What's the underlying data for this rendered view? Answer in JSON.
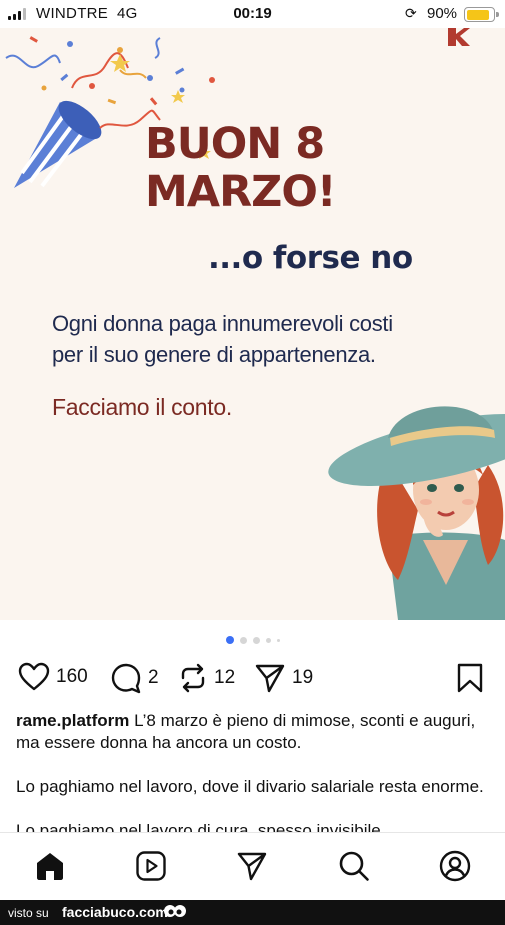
{
  "status_bar": {
    "carrier": "WINDTRE",
    "network": "4G",
    "time": "00:19",
    "battery_percent": "90%",
    "battery_level": 0.9,
    "battery_color": "#f5c518",
    "icons": [
      "signal-icon",
      "rotation-lock-icon",
      "battery-icon"
    ]
  },
  "post_image": {
    "headline_line1": "BUON 8",
    "headline_line2": "MARZO!",
    "subhead": "...o forse no",
    "body_line1": "Ogni donna paga innumerevoli costi",
    "body_line2": "per il suo genere di appartenenza.",
    "cta": "Facciamo il conto.",
    "colors": {
      "background": "#fbf5ef",
      "headline": "#7b2a23",
      "navy": "#1f2a4e"
    }
  },
  "carousel": {
    "pages": 5,
    "active": 0,
    "active_color": "#3b6ff5"
  },
  "actions": {
    "likes": "160",
    "comments": "2",
    "reposts": "12",
    "shares": "19"
  },
  "caption": {
    "username": "rame.platform",
    "text1": "L’8 marzo è pieno di mimose, sconti e auguri, ma essere donna ha ancora un costo.",
    "text2": "Lo paghiamo nel lavoro, dove il divario salariale resta enorme.",
    "text3_partial": "Lo paghiamo nel lavoro di cura, spesso invisibile"
  },
  "bottom_nav": [
    "home-icon",
    "reels-icon",
    "messages-icon",
    "search-icon",
    "profile-icon"
  ],
  "watermark": {
    "prefix": "visto su",
    "site": "facciabuco.com"
  }
}
